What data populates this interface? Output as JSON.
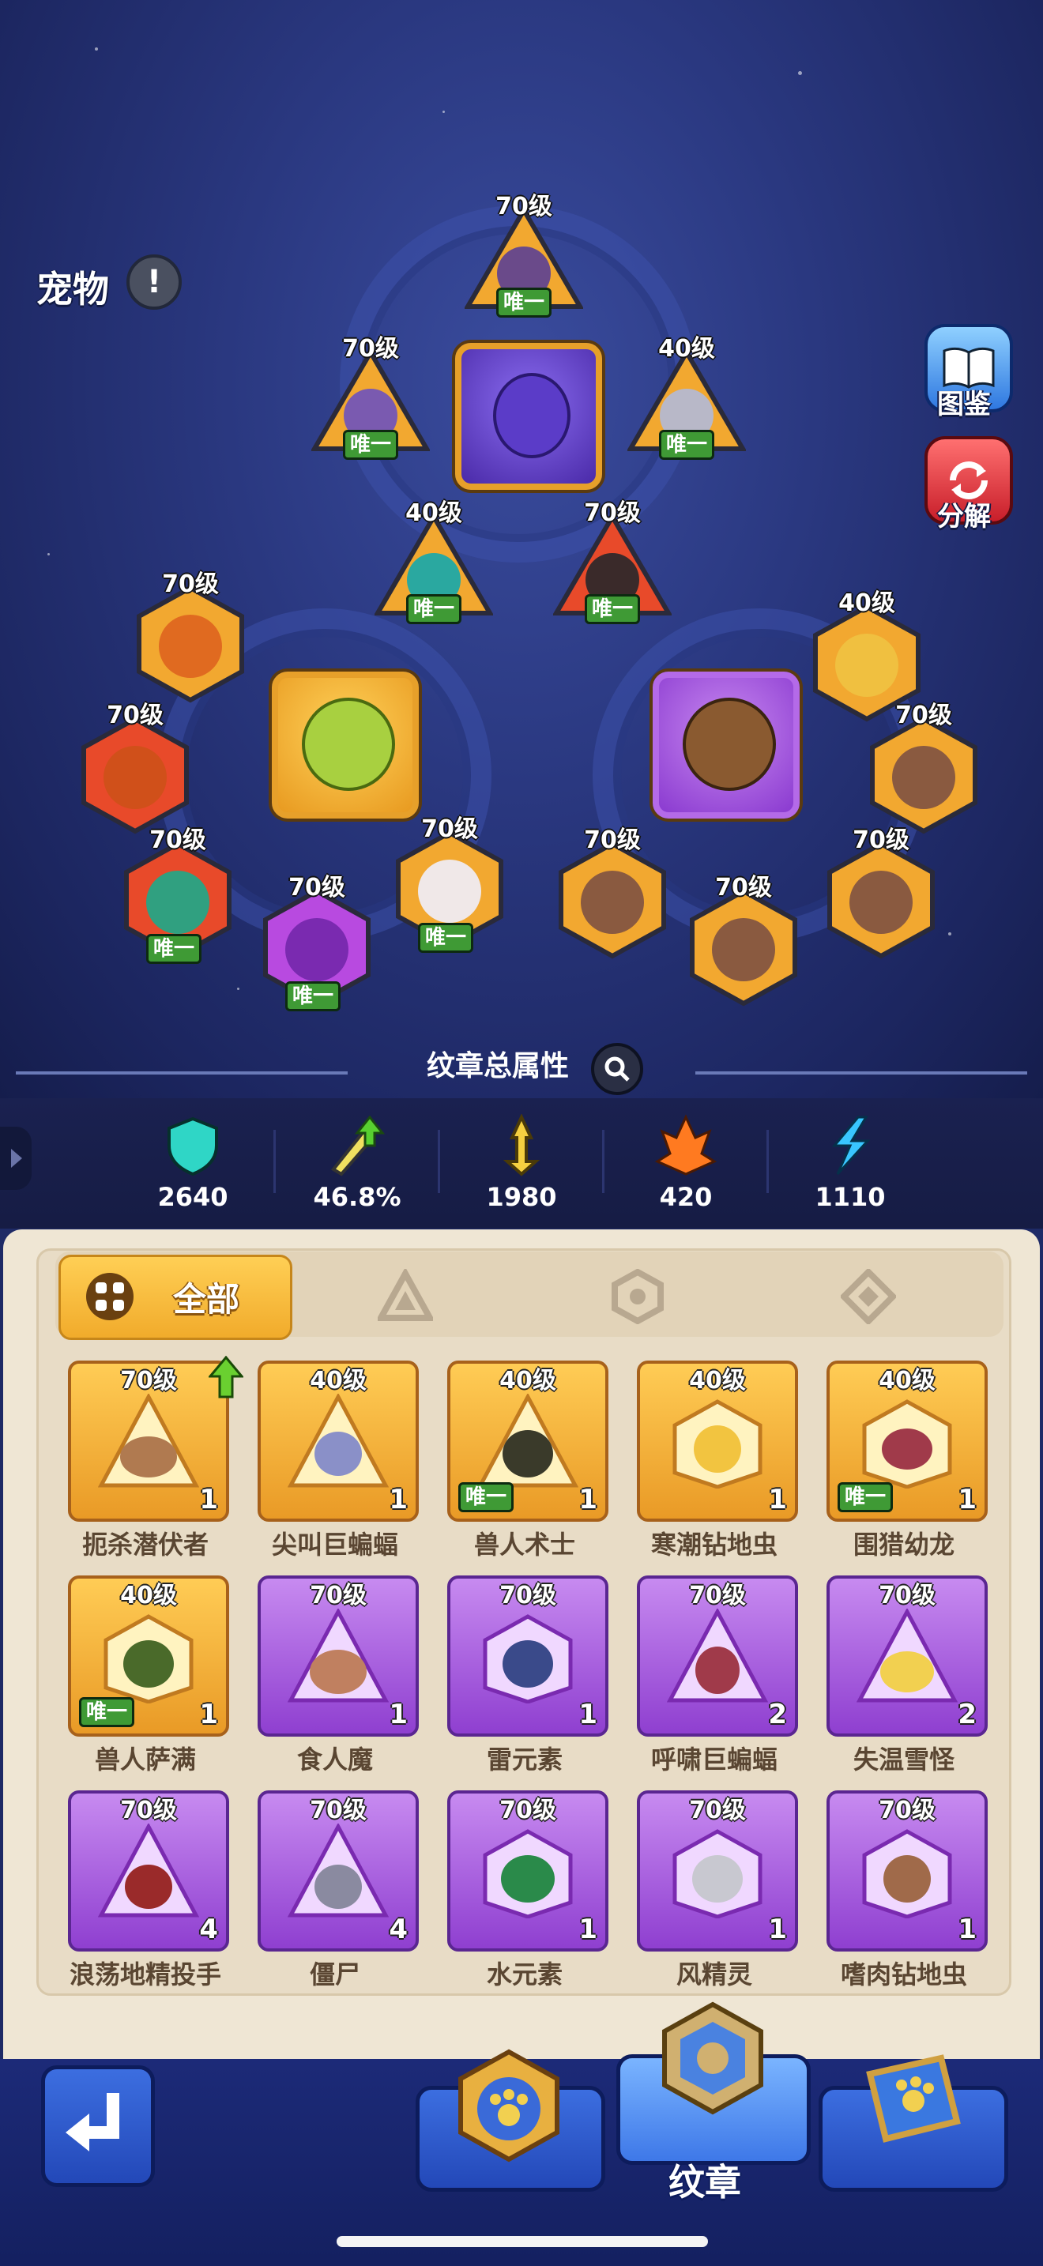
{
  "header": {
    "title": "宠物",
    "warning_icon": "exclamation-icon"
  },
  "side_buttons": {
    "codex_label": "图鉴",
    "decompose_label": "分解"
  },
  "board": {
    "top_group": [
      {
        "level": "70级",
        "unique": "唯一"
      },
      {
        "level": "70级",
        "unique": "唯一"
      },
      {
        "level": "40级",
        "unique": "唯一"
      },
      {
        "level": "40级",
        "unique": "唯一"
      },
      {
        "level": "70级",
        "unique": "唯一"
      }
    ],
    "left_group": [
      {
        "level": "70级"
      },
      {
        "level": "70级"
      },
      {
        "level": "70级",
        "unique": "唯一"
      },
      {
        "level": "70级",
        "unique": "唯一"
      },
      {
        "level": "70级",
        "unique": "唯一"
      }
    ],
    "right_group": [
      {
        "level": "40级"
      },
      {
        "level": "70级"
      },
      {
        "level": "70级"
      },
      {
        "level": "70级"
      },
      {
        "level": "70级"
      }
    ]
  },
  "summary": {
    "title": "纹章总属性"
  },
  "stats": [
    {
      "icon": "shield-icon",
      "value": "2640",
      "color": "#2fd6c6"
    },
    {
      "icon": "sword-up-icon",
      "value": "46.8%",
      "color": "#e8e060"
    },
    {
      "icon": "sword-icon",
      "value": "1980",
      "color": "#f5d040"
    },
    {
      "icon": "fire-icon",
      "value": "420",
      "color": "#ff7a20"
    },
    {
      "icon": "lightning-icon",
      "value": "1110",
      "color": "#39c6ff"
    }
  ],
  "tabs": {
    "all_label": "全部",
    "other_tabs": [
      "triangle-icon",
      "hexagon-icon",
      "diamond-icon"
    ]
  },
  "cards": [
    {
      "level": "70级",
      "count": "1",
      "name": "扼杀潜伏者",
      "rarity": "gold",
      "upgrade": true
    },
    {
      "level": "40级",
      "count": "1",
      "name": "尖叫巨蝙蝠",
      "rarity": "gold"
    },
    {
      "level": "40级",
      "count": "1",
      "name": "兽人术士",
      "rarity": "gold",
      "unique": "唯一"
    },
    {
      "level": "40级",
      "count": "1",
      "name": "寒潮钻地虫",
      "rarity": "gold"
    },
    {
      "level": "40级",
      "count": "1",
      "name": "围猎幼龙",
      "rarity": "gold",
      "unique": "唯一"
    },
    {
      "level": "40级",
      "count": "1",
      "name": "兽人萨满",
      "rarity": "gold",
      "unique": "唯一"
    },
    {
      "level": "70级",
      "count": "1",
      "name": "食人魔",
      "rarity": "purple"
    },
    {
      "level": "70级",
      "count": "1",
      "name": "雷元素",
      "rarity": "purple"
    },
    {
      "level": "70级",
      "count": "2",
      "name": "呼啸巨蝙蝠",
      "rarity": "purple"
    },
    {
      "level": "70级",
      "count": "2",
      "name": "失温雪怪",
      "rarity": "purple"
    },
    {
      "level": "70级",
      "count": "4",
      "name": "浪荡地精投手",
      "rarity": "purple"
    },
    {
      "level": "70级",
      "count": "4",
      "name": "僵尸",
      "rarity": "purple"
    },
    {
      "level": "70级",
      "count": "1",
      "name": "水元素",
      "rarity": "purple"
    },
    {
      "level": "70级",
      "count": "1",
      "name": "风精灵",
      "rarity": "purple"
    },
    {
      "level": "70级",
      "count": "1",
      "name": "嗜肉钻地虫",
      "rarity": "purple"
    }
  ],
  "bottom_nav": {
    "active_label": "纹章"
  }
}
